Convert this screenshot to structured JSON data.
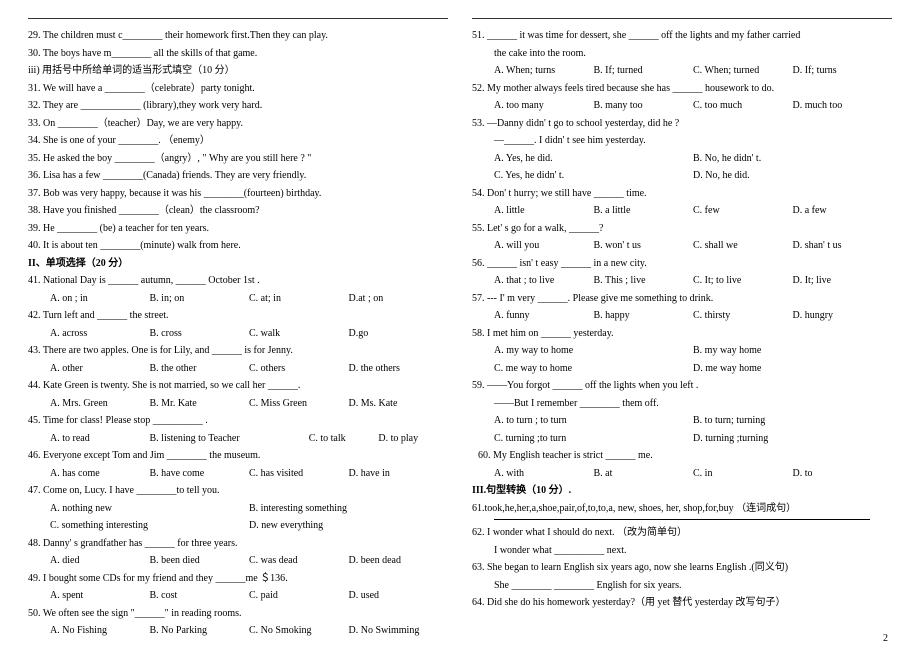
{
  "left": {
    "q29": "29. The children must c________ their homework first.Then they can play.",
    "q30": "30. The boys have m________ all the skills of that game.",
    "sec_iii": "iii) 用括号中所给单词的适当形式填空（10 分）",
    "q31": "31. We will have a ________（celebrate）party tonight.",
    "q32": "32. They are ____________ (library),they work very hard.",
    "q33": "33. On ________（teacher）Day, we are very happy.",
    "q34": "34. She is one of your ________. （enemy）",
    "q35": "35. He asked the boy ________（angry）, \" Why are you still here ? \"",
    "q36": "36. Lisa has a few ________(Canada) friends. They are very friendly.",
    "q37": "37. Bob was very happy, because it was his ________(fourteen) birthday.",
    "q38": "38. Have you finished ________（clean）the classroom?",
    "q39": "39. He ________ (be) a teacher for ten years.",
    "q40": "40. It is about ten ________(minute) walk from here.",
    "sec_II": "II、单项选择（20 分）",
    "q41": "41. National Day is ______ autumn, ______ October 1st .",
    "q41o": {
      "a": "A. on ; in",
      "b": "B. in; on",
      "c": "C. at; in",
      "d": "D.at ; on"
    },
    "q42": "42. Turn left and ______ the street.",
    "q42o": {
      "a": "A. across",
      "b": "B. cross",
      "c": "C. walk",
      "d": "D.go"
    },
    "q43": "43. There are two apples. One is for Lily, and ______ is for Jenny.",
    "q43o": {
      "a": "A. other",
      "b": "B. the other",
      "c": "C. others",
      "d": "D. the others"
    },
    "q44": "44. Kate Green is twenty. She is not married, so we call her ______.",
    "q44o": {
      "a": "A. Mrs. Green",
      "b": "B. Mr. Kate",
      "c": "C. Miss Green",
      "d": "D. Ms. Kate"
    },
    "q45": "45. Time for class! Please stop __________ .",
    "q45o": {
      "a": "A. to read",
      "b": "B. listening to Teacher",
      "c": "C. to talk",
      "d": "D. to play"
    },
    "q46": "46. Everyone except Tom and Jim ________ the museum.",
    "q46o": {
      "a": "A. has come",
      "b": "B. have come",
      "c": "C. has visited",
      "d": "D. have in"
    },
    "q47": "47. Come on, Lucy. I have ________to tell you.",
    "q47o": {
      "a": "A. nothing new",
      "b": "B. interesting something",
      "c": "C. something interesting",
      "d": "D. new everything"
    },
    "q48": "48. Danny' s grandfather has ______ for three years.",
    "q48o": {
      "a": "A. died",
      "b": "B. been died",
      "c": "C. was dead",
      "d": "D. been dead"
    },
    "q49": "49. I bought some CDs for my friend and they ______me ＄136.",
    "q49o": {
      "a": "A. spent",
      "b": "B. cost",
      "c": "C. paid",
      "d": "D. used"
    },
    "q50": "50. We often see the sign \"______\" in reading rooms.",
    "q50o": {
      "a": "A. No Fishing",
      "b": "B. No Parking",
      "c": "C. No Smoking",
      "d": "D. No Swimming"
    }
  },
  "right": {
    "q51a": "51. ______  it was time for dessert, she  ______ off the lights and my father carried",
    "q51b": "the cake into the room.",
    "q51o": {
      "a": "A. When; turns",
      "b": "B. If; turned",
      "c": "C. When; turned",
      "d": "D. If; turns"
    },
    "q52": "52. My mother always feels tired because she has ______ housework to do.",
    "q52o": {
      "a": "A. too many",
      "b": "B. many too",
      "c": "C. too much",
      "d": "D. much too"
    },
    "q53a": "53. —Danny didn' t go to school yesterday, did he ?",
    "q53b": "—______. I didn' t see him yesterday.",
    "q53o": {
      "a": "A. Yes, he did.",
      "b": "B. No, he didn' t.",
      "c": "C. Yes, he didn' t.",
      "d": "D. No, he did."
    },
    "q54": "54. Don' t hurry; we still have ______ time.",
    "q54o": {
      "a": "A. little",
      "b": "B. a little",
      "c": "C. few",
      "d": "D. a few"
    },
    "q55": "55. Let' s go for a walk, ______?",
    "q55o": {
      "a": "A. will you",
      "b": "B. won' t us",
      "c": "C. shall we",
      "d": "D. shan' t us"
    },
    "q56": "56. ______ isn' t easy ______ in a new city.",
    "q56o": {
      "a": "A. that ; to live",
      "b": "B. This ; live",
      "c": "C. It; to live",
      "d": "D. It; live"
    },
    "q57": "57. --- I' m very ______. Please give me something to drink.",
    "q57o": {
      "a": "A. funny",
      "b": "B. happy",
      "c": "C. thirsty",
      "d": "D. hungry"
    },
    "q58": "58. I met him on ______ yesterday.",
    "q58o": {
      "a": "A. my way to home",
      "b": "B. my way home",
      "c": "C. me way to home",
      "d": "D. me way home"
    },
    "q59a": "59. ——You forgot ______ off the lights when you left .",
    "q59b": "——But I remember ________ them off.",
    "q59o": {
      "a": "A. to turn ; to turn",
      "b": "B. to turn; turning",
      "c": "C. turning ;to turn",
      "d": "D. turning ;turning"
    },
    "q60": "60. My English teacher is strict ______ me.",
    "q60o": {
      "a": "A. with",
      "b": "B. at",
      "c": "C. in",
      "d": "D. to"
    },
    "sec_III": "III.句型转换（10 分）.",
    "q61": "61.took,he,her,a,shoe,pair,of,to,to,a, new, shoes, her, shop,for,buy （连词成句）",
    "q62a": "62. I wonder what I should do next. （改为简单句）",
    "q62b": "I wonder what __________ next.",
    "q63a": "63. She began to learn English six years ago, now she learns English .(同义句)",
    "q63b": "She ________ ________ English for six years.",
    "q64": "64. Did she do his homework yesterday?（用 yet  替代 yesterday  改写句子）"
  },
  "page_number": "2"
}
